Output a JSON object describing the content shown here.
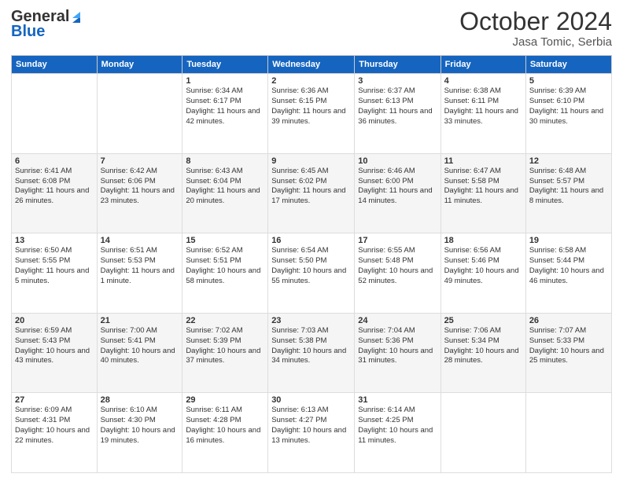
{
  "header": {
    "logo_line1": "General",
    "logo_line2": "Blue",
    "title": "October 2024",
    "subtitle": "Jasa Tomic, Serbia"
  },
  "days_of_week": [
    "Sunday",
    "Monday",
    "Tuesday",
    "Wednesday",
    "Thursday",
    "Friday",
    "Saturday"
  ],
  "weeks": [
    [
      {
        "day": "",
        "info": ""
      },
      {
        "day": "",
        "info": ""
      },
      {
        "day": "1",
        "info": "Sunrise: 6:34 AM\nSunset: 6:17 PM\nDaylight: 11 hours and 42 minutes."
      },
      {
        "day": "2",
        "info": "Sunrise: 6:36 AM\nSunset: 6:15 PM\nDaylight: 11 hours and 39 minutes."
      },
      {
        "day": "3",
        "info": "Sunrise: 6:37 AM\nSunset: 6:13 PM\nDaylight: 11 hours and 36 minutes."
      },
      {
        "day": "4",
        "info": "Sunrise: 6:38 AM\nSunset: 6:11 PM\nDaylight: 11 hours and 33 minutes."
      },
      {
        "day": "5",
        "info": "Sunrise: 6:39 AM\nSunset: 6:10 PM\nDaylight: 11 hours and 30 minutes."
      }
    ],
    [
      {
        "day": "6",
        "info": "Sunrise: 6:41 AM\nSunset: 6:08 PM\nDaylight: 11 hours and 26 minutes."
      },
      {
        "day": "7",
        "info": "Sunrise: 6:42 AM\nSunset: 6:06 PM\nDaylight: 11 hours and 23 minutes."
      },
      {
        "day": "8",
        "info": "Sunrise: 6:43 AM\nSunset: 6:04 PM\nDaylight: 11 hours and 20 minutes."
      },
      {
        "day": "9",
        "info": "Sunrise: 6:45 AM\nSunset: 6:02 PM\nDaylight: 11 hours and 17 minutes."
      },
      {
        "day": "10",
        "info": "Sunrise: 6:46 AM\nSunset: 6:00 PM\nDaylight: 11 hours and 14 minutes."
      },
      {
        "day": "11",
        "info": "Sunrise: 6:47 AM\nSunset: 5:58 PM\nDaylight: 11 hours and 11 minutes."
      },
      {
        "day": "12",
        "info": "Sunrise: 6:48 AM\nSunset: 5:57 PM\nDaylight: 11 hours and 8 minutes."
      }
    ],
    [
      {
        "day": "13",
        "info": "Sunrise: 6:50 AM\nSunset: 5:55 PM\nDaylight: 11 hours and 5 minutes."
      },
      {
        "day": "14",
        "info": "Sunrise: 6:51 AM\nSunset: 5:53 PM\nDaylight: 11 hours and 1 minute."
      },
      {
        "day": "15",
        "info": "Sunrise: 6:52 AM\nSunset: 5:51 PM\nDaylight: 10 hours and 58 minutes."
      },
      {
        "day": "16",
        "info": "Sunrise: 6:54 AM\nSunset: 5:50 PM\nDaylight: 10 hours and 55 minutes."
      },
      {
        "day": "17",
        "info": "Sunrise: 6:55 AM\nSunset: 5:48 PM\nDaylight: 10 hours and 52 minutes."
      },
      {
        "day": "18",
        "info": "Sunrise: 6:56 AM\nSunset: 5:46 PM\nDaylight: 10 hours and 49 minutes."
      },
      {
        "day": "19",
        "info": "Sunrise: 6:58 AM\nSunset: 5:44 PM\nDaylight: 10 hours and 46 minutes."
      }
    ],
    [
      {
        "day": "20",
        "info": "Sunrise: 6:59 AM\nSunset: 5:43 PM\nDaylight: 10 hours and 43 minutes."
      },
      {
        "day": "21",
        "info": "Sunrise: 7:00 AM\nSunset: 5:41 PM\nDaylight: 10 hours and 40 minutes."
      },
      {
        "day": "22",
        "info": "Sunrise: 7:02 AM\nSunset: 5:39 PM\nDaylight: 10 hours and 37 minutes."
      },
      {
        "day": "23",
        "info": "Sunrise: 7:03 AM\nSunset: 5:38 PM\nDaylight: 10 hours and 34 minutes."
      },
      {
        "day": "24",
        "info": "Sunrise: 7:04 AM\nSunset: 5:36 PM\nDaylight: 10 hours and 31 minutes."
      },
      {
        "day": "25",
        "info": "Sunrise: 7:06 AM\nSunset: 5:34 PM\nDaylight: 10 hours and 28 minutes."
      },
      {
        "day": "26",
        "info": "Sunrise: 7:07 AM\nSunset: 5:33 PM\nDaylight: 10 hours and 25 minutes."
      }
    ],
    [
      {
        "day": "27",
        "info": "Sunrise: 6:09 AM\nSunset: 4:31 PM\nDaylight: 10 hours and 22 minutes."
      },
      {
        "day": "28",
        "info": "Sunrise: 6:10 AM\nSunset: 4:30 PM\nDaylight: 10 hours and 19 minutes."
      },
      {
        "day": "29",
        "info": "Sunrise: 6:11 AM\nSunset: 4:28 PM\nDaylight: 10 hours and 16 minutes."
      },
      {
        "day": "30",
        "info": "Sunrise: 6:13 AM\nSunset: 4:27 PM\nDaylight: 10 hours and 13 minutes."
      },
      {
        "day": "31",
        "info": "Sunrise: 6:14 AM\nSunset: 4:25 PM\nDaylight: 10 hours and 11 minutes."
      },
      {
        "day": "",
        "info": ""
      },
      {
        "day": "",
        "info": ""
      }
    ]
  ]
}
